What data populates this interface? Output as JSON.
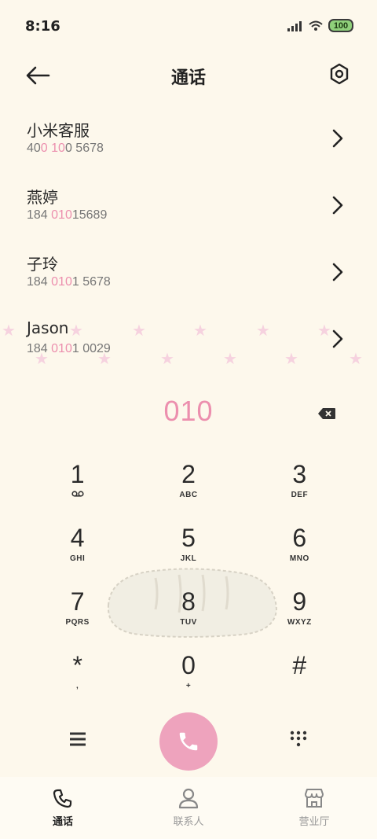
{
  "status_bar": {
    "time": "8:16",
    "battery": "100"
  },
  "header": {
    "title": "通话"
  },
  "contacts": [
    {
      "name": "小米客服",
      "number_parts": [
        "40",
        "0",
        " ",
        "10",
        "0 5678"
      ],
      "highlight": [
        false,
        true,
        false,
        true,
        false
      ]
    },
    {
      "name": "燕婷",
      "number_parts": [
        "184 ",
        "010",
        "15689"
      ],
      "highlight": [
        false,
        true,
        false
      ]
    },
    {
      "name": "子玲",
      "number_parts": [
        "184 ",
        "010",
        "1 5678"
      ],
      "highlight": [
        false,
        true,
        false
      ]
    },
    {
      "name": "Jason",
      "number_parts": [
        "184 ",
        "010",
        "1 0029"
      ],
      "highlight": [
        false,
        true,
        false
      ]
    }
  ],
  "dialer": {
    "entered_number": "010"
  },
  "keypad": [
    {
      "digit": "1",
      "letters": ""
    },
    {
      "digit": "2",
      "letters": "ABC"
    },
    {
      "digit": "3",
      "letters": "DEF"
    },
    {
      "digit": "4",
      "letters": "GHI"
    },
    {
      "digit": "5",
      "letters": "JKL"
    },
    {
      "digit": "6",
      "letters": "MNO"
    },
    {
      "digit": "7",
      "letters": "PQRS"
    },
    {
      "digit": "8",
      "letters": "TUV"
    },
    {
      "digit": "9",
      "letters": "WXYZ"
    },
    {
      "digit": "*",
      "letters": ","
    },
    {
      "digit": "0",
      "letters": "+"
    },
    {
      "digit": "#",
      "letters": ""
    }
  ],
  "bottom_nav": {
    "tabs": [
      {
        "label": "通话",
        "icon": "phone-icon",
        "active": true
      },
      {
        "label": "联系人",
        "icon": "person-icon",
        "active": false
      },
      {
        "label": "营业厅",
        "icon": "store-icon",
        "active": false
      }
    ]
  },
  "colors": {
    "accent": "#ec8fae",
    "call_button": "#eea3bd",
    "background": "#fdf8ec",
    "battery": "#8fd07a"
  }
}
